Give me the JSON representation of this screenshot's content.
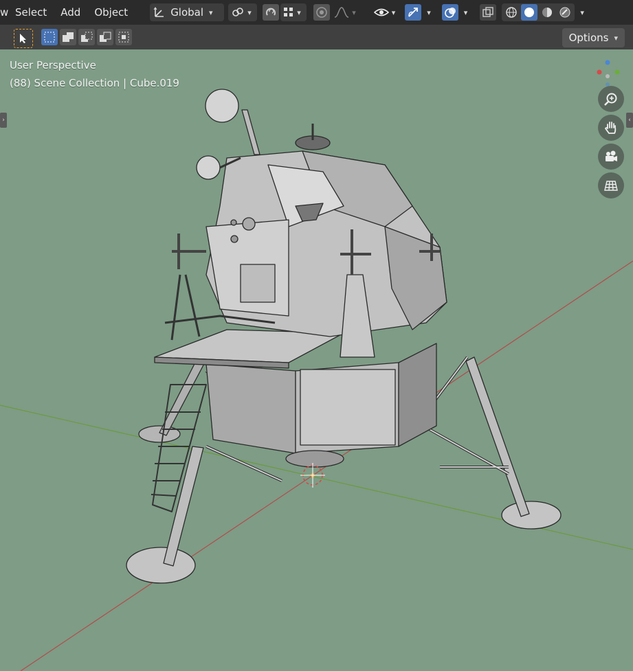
{
  "header": {
    "menu": [
      "w",
      "Select",
      "Add",
      "Object"
    ],
    "orientation": {
      "label": "Global",
      "icon": "transform-orientation-icon"
    },
    "pivot_icon": "pivot-point-icon",
    "snap_icon": "snap-magnet-icon",
    "snap_target_icon": "snap-target-icon",
    "proportional_icon": "proportional-edit-icon",
    "falloff_icon": "falloff-curve-icon",
    "visibility_icon": "eye-visibility-icon",
    "gizmo_icon": "gizmo-icon",
    "overlay_icon": "overlays-icon",
    "xray_icon": "xray-icon",
    "shading": [
      "wireframe-shading-icon",
      "solid-shading-icon",
      "material-preview-icon",
      "rendered-shading-icon"
    ],
    "active_shading": "solid"
  },
  "toolbar": {
    "tool_icon": "select-cursor-icon",
    "modes": [
      "select-new-icon",
      "select-extend-icon",
      "select-subtract-icon",
      "select-invert-icon",
      "select-intersect-icon"
    ],
    "options_label": "Options"
  },
  "viewport": {
    "perspective": "User Perspective",
    "collection": "(88) Scene Collection | Cube.019",
    "nav": [
      "zoom-icon",
      "pan-hand-icon",
      "camera-view-icon",
      "ortho-grid-icon"
    ],
    "colors": {
      "background": "#7e9c86",
      "x_axis": "#b54a4a",
      "y_axis": "#6d9a3c",
      "model": "#b8b8b8"
    }
  }
}
